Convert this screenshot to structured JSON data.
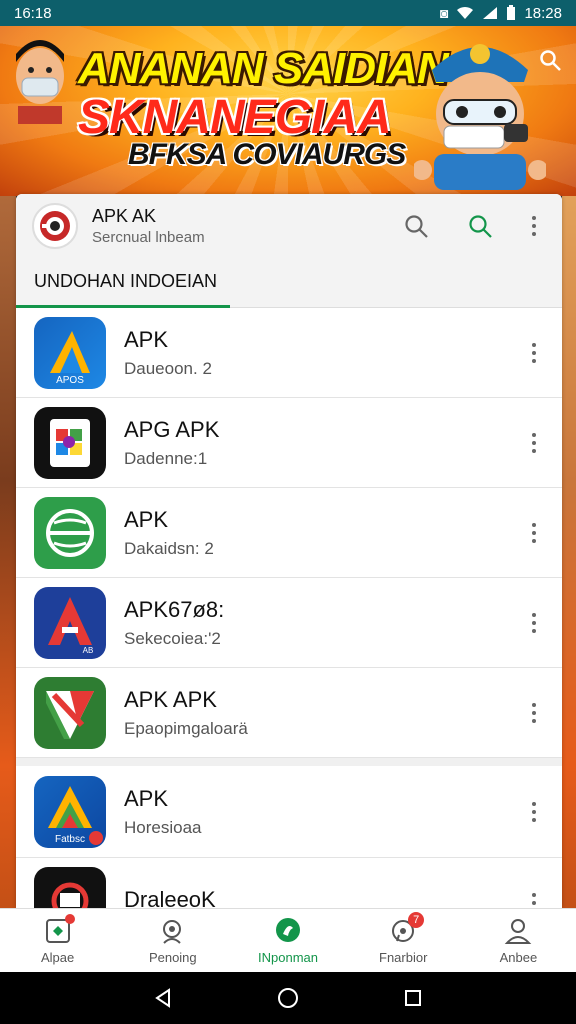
{
  "status_bar": {
    "time_left": "16:18",
    "time_right": "18:28"
  },
  "banner": {
    "line1": "ANANAN SAIDIAN",
    "line2": "SKNANEGIAA",
    "line3": "BFKSA COVIAURGS",
    "search_icon": "search-icon"
  },
  "card": {
    "title": "APK AK",
    "subtitle": "Sercnual lnbeam",
    "tab_label": "UNDOHAN INDOEIAN"
  },
  "apps": [
    {
      "name": "APK",
      "sub": "Daueoon. 2"
    },
    {
      "name": "APG APK",
      "sub": "Dadenne:1"
    },
    {
      "name": "APK",
      "sub": "Dakaidsn: 2"
    },
    {
      "name": "APK67ø8:",
      "sub": "Sekecoiea:'2"
    },
    {
      "name": "APK APK",
      "sub": "Epaopimgaloarä"
    },
    {
      "name": "APK",
      "sub": "Horesioaa"
    },
    {
      "name": "DraleeoK",
      "sub": ""
    }
  ],
  "bottom_nav": [
    {
      "label": "Alpae",
      "badge": ""
    },
    {
      "label": "Penoing",
      "badge": ""
    },
    {
      "label": "INponman",
      "badge": ""
    },
    {
      "label": "Fnarbior",
      "badge": "7"
    },
    {
      "label": "Anbee",
      "badge": ""
    }
  ],
  "colors": {
    "status_bar": "#0d5f6b",
    "accent": "#13954a",
    "badge": "#e53935"
  }
}
